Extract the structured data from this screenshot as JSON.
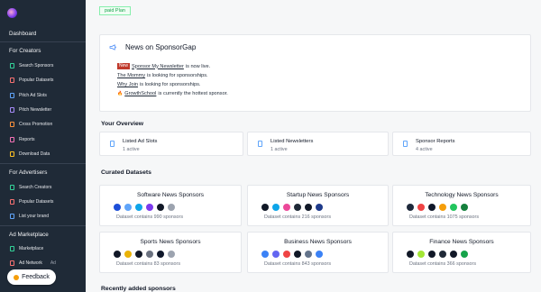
{
  "sidebar": {
    "dashboard": "Dashboard",
    "sections": {
      "creators": "For Creators",
      "advertisers": "For Advertisers",
      "marketplace": "Ad Marketplace"
    },
    "creator_items": [
      {
        "label": "Search Sponsors",
        "icon": "search-icon",
        "color": "#34d399"
      },
      {
        "label": "Popular Datasets",
        "icon": "star-icon",
        "color": "#f87171"
      },
      {
        "label": "Pitch Ad Slots",
        "icon": "document-icon",
        "color": "#60a5fa"
      },
      {
        "label": "Pitch Newsletter",
        "icon": "mail-icon",
        "color": "#a78bfa"
      },
      {
        "label": "Cross Promotion",
        "icon": "swap-icon",
        "color": "#fb923c"
      },
      {
        "label": "Reports",
        "icon": "chart-icon",
        "color": "#f472b6"
      },
      {
        "label": "Download Data",
        "icon": "download-icon",
        "color": "#fbbf24"
      }
    ],
    "advertiser_items": [
      {
        "label": "Search Creators",
        "icon": "search-icon",
        "color": "#34d399"
      },
      {
        "label": "Popular Datasets",
        "icon": "star-icon",
        "color": "#f87171"
      },
      {
        "label": "List your brand",
        "icon": "document-icon",
        "color": "#60a5fa"
      }
    ],
    "marketplace_items": [
      {
        "label": "Marketplace",
        "icon": "store-icon",
        "color": "#34d399"
      },
      {
        "label": "Ad Network",
        "icon": "network-icon",
        "color": "#f87171"
      }
    ],
    "ad_network_suffix": "Ad",
    "feedback_label": "Feedback"
  },
  "main": {
    "plan_badge": "paid Plan",
    "news": {
      "title": "News on SponsorGap",
      "new_tag": "New",
      "line1_link": "Sponsor My Newsletter",
      "line1_rest": "is now live.",
      "line2_link": "The Mommy",
      "line2_rest": "is looking for sponsorships.",
      "line3_link": "Why Join",
      "line3_rest": "is looking for sponsorships.",
      "line4_emoji": "🔥",
      "line4_link": "GrowthSchool",
      "line4_rest": "is currently the hottest sponsor."
    },
    "overview": {
      "title": "Your Overview",
      "cards": [
        {
          "title": "Listed Ad Slots",
          "sub": "1 active"
        },
        {
          "title": "Listed Newsletters",
          "sub": "1 active"
        },
        {
          "title": "Sponsor Reports",
          "sub": "4 active"
        }
      ]
    },
    "datasets": {
      "title": "Curated Datasets",
      "cards": [
        {
          "title": "Software News Sponsors",
          "count": "Dataset contains 990 sponsors",
          "logos": [
            "#1d4ed8",
            "#60a5fa",
            "#0ea5e9",
            "#7c3aed",
            "#111827",
            "#9ca3af"
          ]
        },
        {
          "title": "Startup News Sponsors",
          "count": "Dataset contains 216 sponsors",
          "logos": [
            "#111827",
            "#0ea5e9",
            "#ec4899",
            "#1f2937",
            "#111827",
            "#1e3a8a"
          ]
        },
        {
          "title": "Technology News Sponsors",
          "count": "Dataset contains 1075 sponsors",
          "logos": [
            "#1e293b",
            "#ef4444",
            "#0f172a",
            "#f59e0b",
            "#22c55e",
            "#15803d"
          ]
        },
        {
          "title": "Sports News Sponsors",
          "count": "Dataset contains 83 sponsors",
          "logos": [
            "#111827",
            "#eab308",
            "#111827",
            "#6b7280",
            "#0f172a",
            "#9ca3af"
          ]
        },
        {
          "title": "Business News Sponsors",
          "count": "Dataset contains 843 sponsors",
          "logos": [
            "#3b82f6",
            "#6366f1",
            "#ef4444",
            "#111827",
            "#64748b",
            "#3b82f6"
          ]
        },
        {
          "title": "Finance News Sponsors",
          "count": "Dataset contains 366 sponsors",
          "logos": [
            "#111827",
            "#a3e635",
            "#111827",
            "#1f2937",
            "#111827",
            "#16a34a"
          ]
        }
      ]
    },
    "recent_title": "Recently added sponsors"
  }
}
